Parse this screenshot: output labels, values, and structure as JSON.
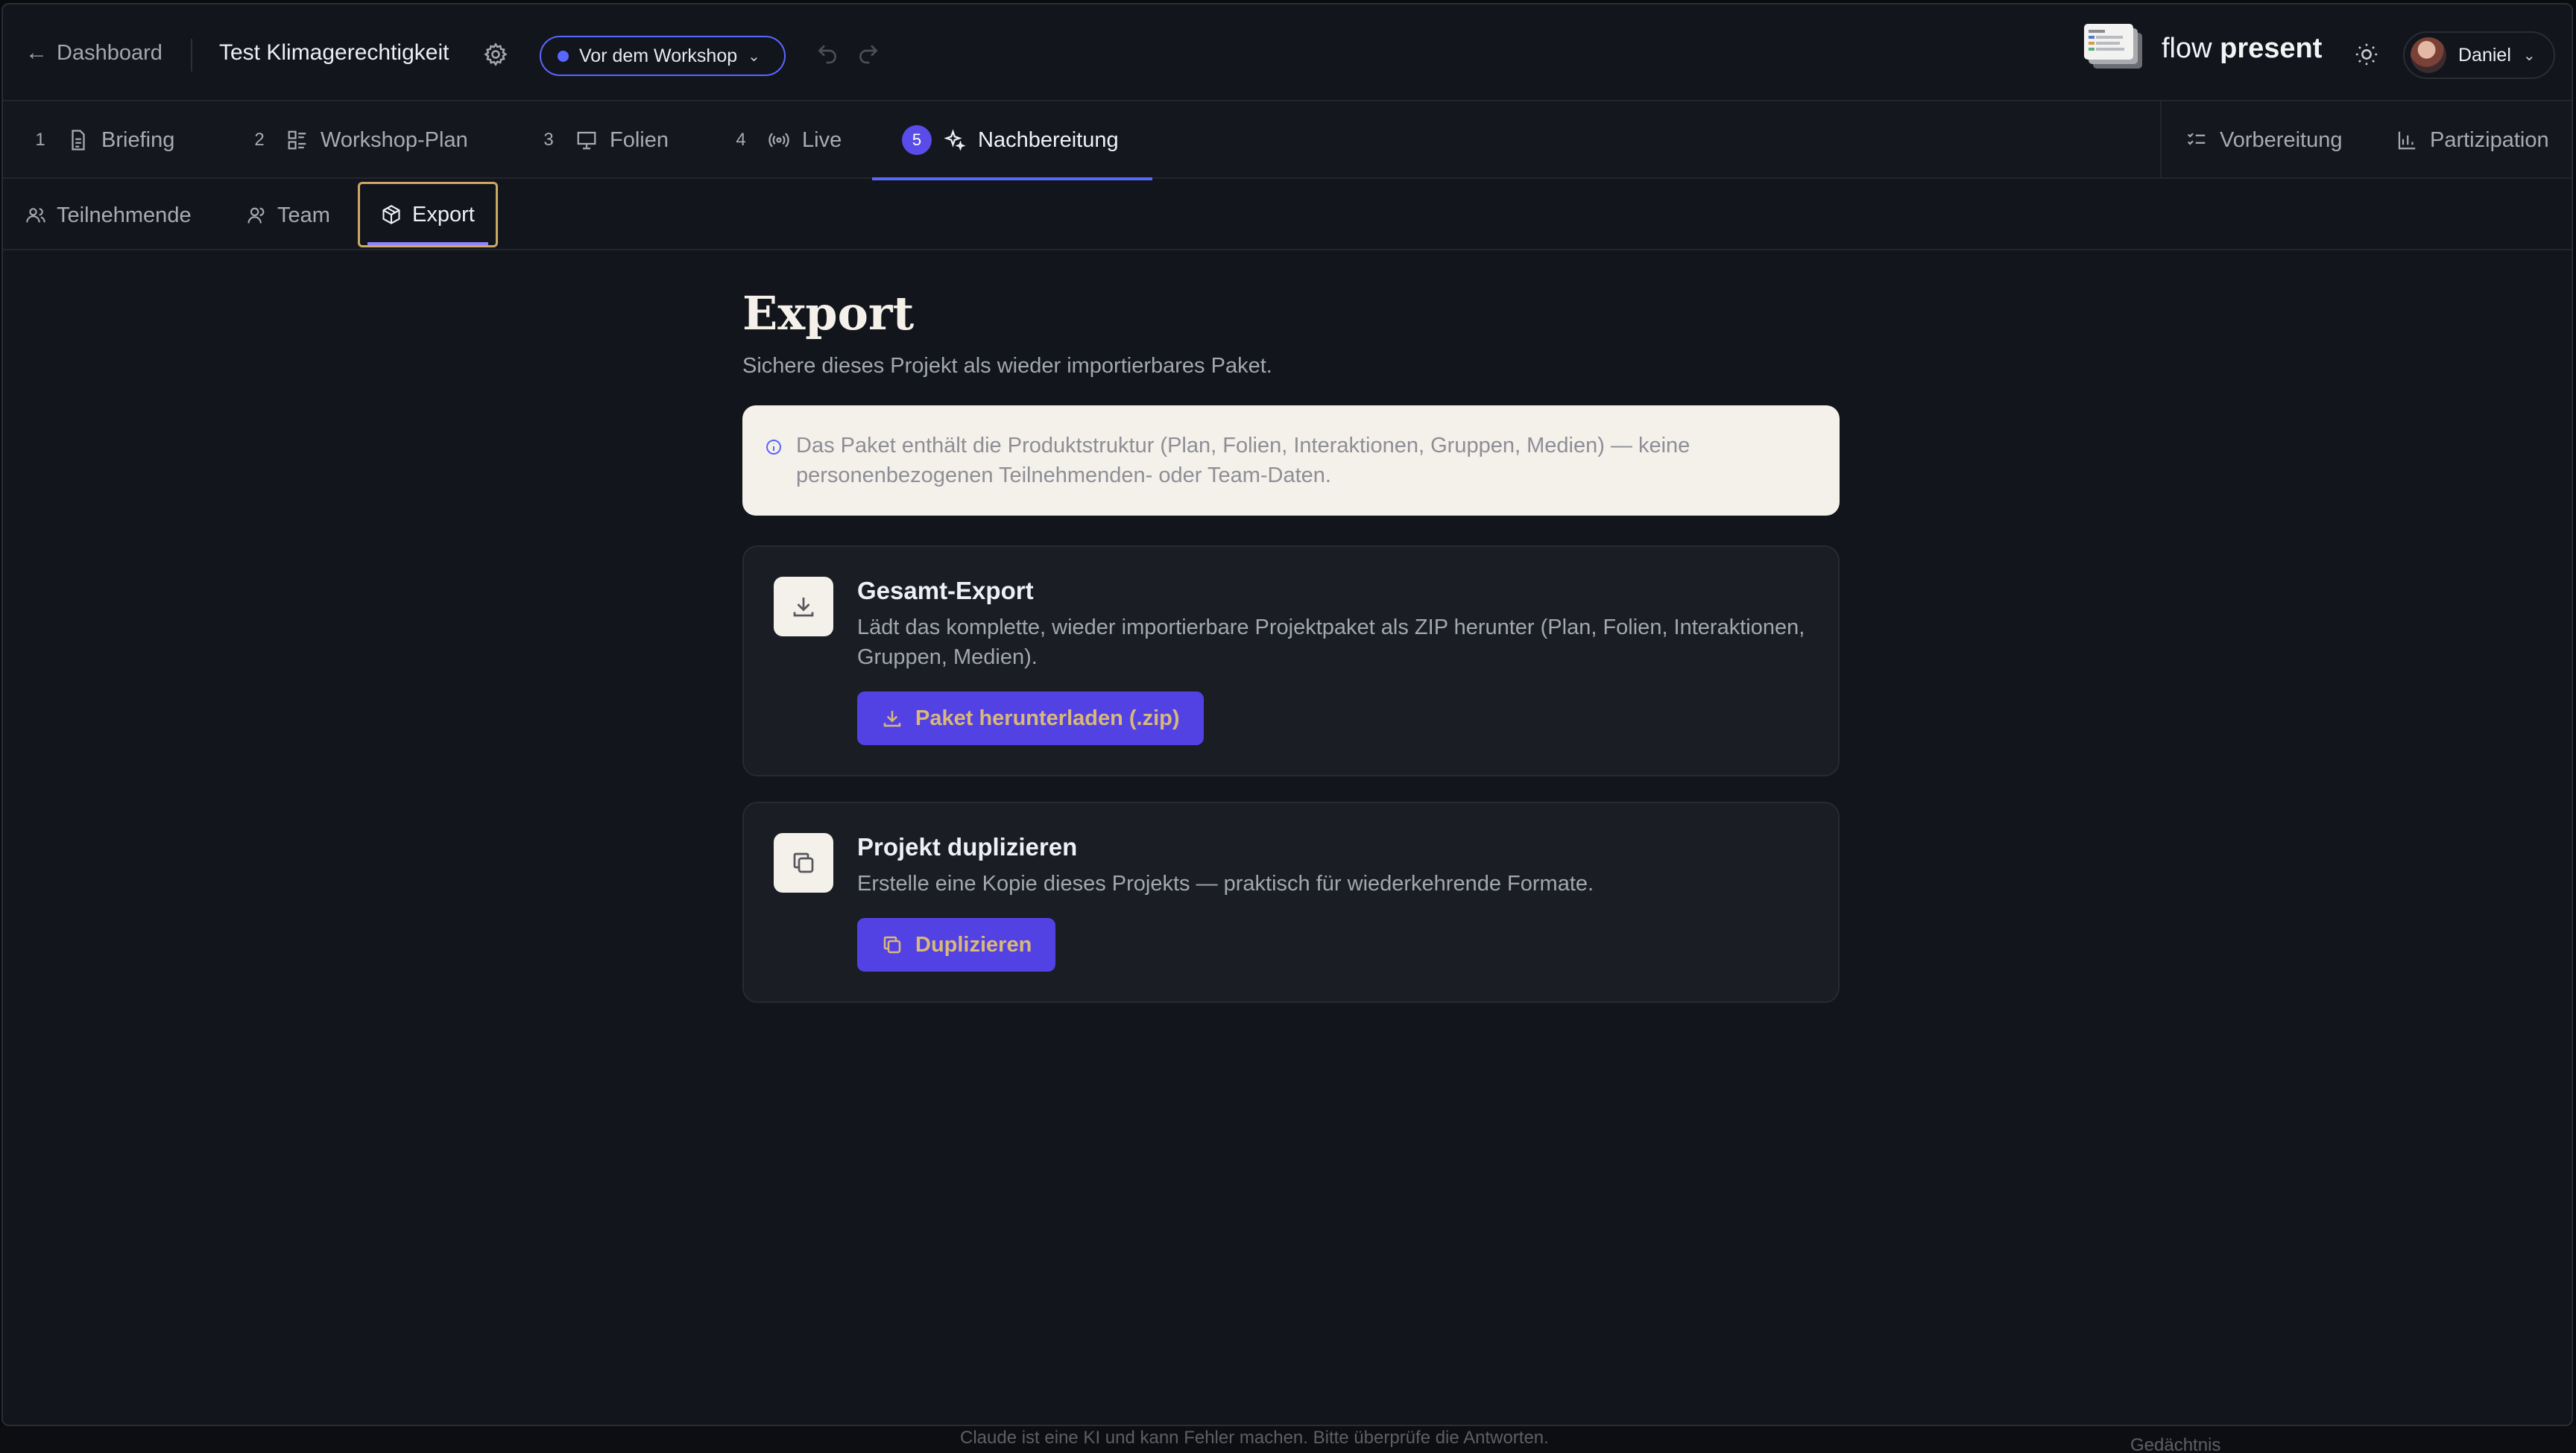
{
  "topbar": {
    "back_label": "Dashboard",
    "project_title": "Test Klimagerechtigkeit",
    "phase": "Vor dem Workshop",
    "brand_light": "flow ",
    "brand_bold": "present",
    "user_name": "Daniel"
  },
  "main_tabs": [
    {
      "num": "1",
      "label": "Briefing"
    },
    {
      "num": "2",
      "label": "Workshop-Plan"
    },
    {
      "num": "3",
      "label": "Folien"
    },
    {
      "num": "4",
      "label": "Live"
    },
    {
      "num": "5",
      "label": "Nachbereitung"
    }
  ],
  "right_tabs": [
    {
      "label": "Vorbereitung"
    },
    {
      "label": "Partizipation"
    }
  ],
  "sub_tabs": [
    {
      "label": "Teilnehmende"
    },
    {
      "label": "Team"
    },
    {
      "label": "Export"
    }
  ],
  "page": {
    "title": "Export",
    "subtitle": "Sichere dieses Projekt als wieder importierbares Paket.",
    "info": "Das Paket enthält die Produktstruktur (Plan, Folien, Interaktionen, Gruppen, Medien) — keine personenbezogenen Teilnehmenden- oder Team-Daten."
  },
  "cards": [
    {
      "title": "Gesamt-Export",
      "desc": "Lädt das komplette, wieder importierbare Projektpaket als ZIP herunter (Plan, Folien, Interaktionen, Gruppen, Medien).",
      "button": "Paket herunterladen (.zip)"
    },
    {
      "title": "Projekt duplizieren",
      "desc": "Erstelle eine Kopie dieses Projekts — praktisch für wiederkehrende Formate.",
      "button": "Duplizieren"
    }
  ],
  "bottom": {
    "footnote": "Claude ist eine KI und kann Fehler machen. Bitte überprüfe die Antworten.",
    "memory": "Gedächtnis"
  },
  "colors": {
    "accent": "#5a67ff",
    "button": "#5242e3",
    "button_text": "#d9b878",
    "highlight": "#caa964"
  }
}
